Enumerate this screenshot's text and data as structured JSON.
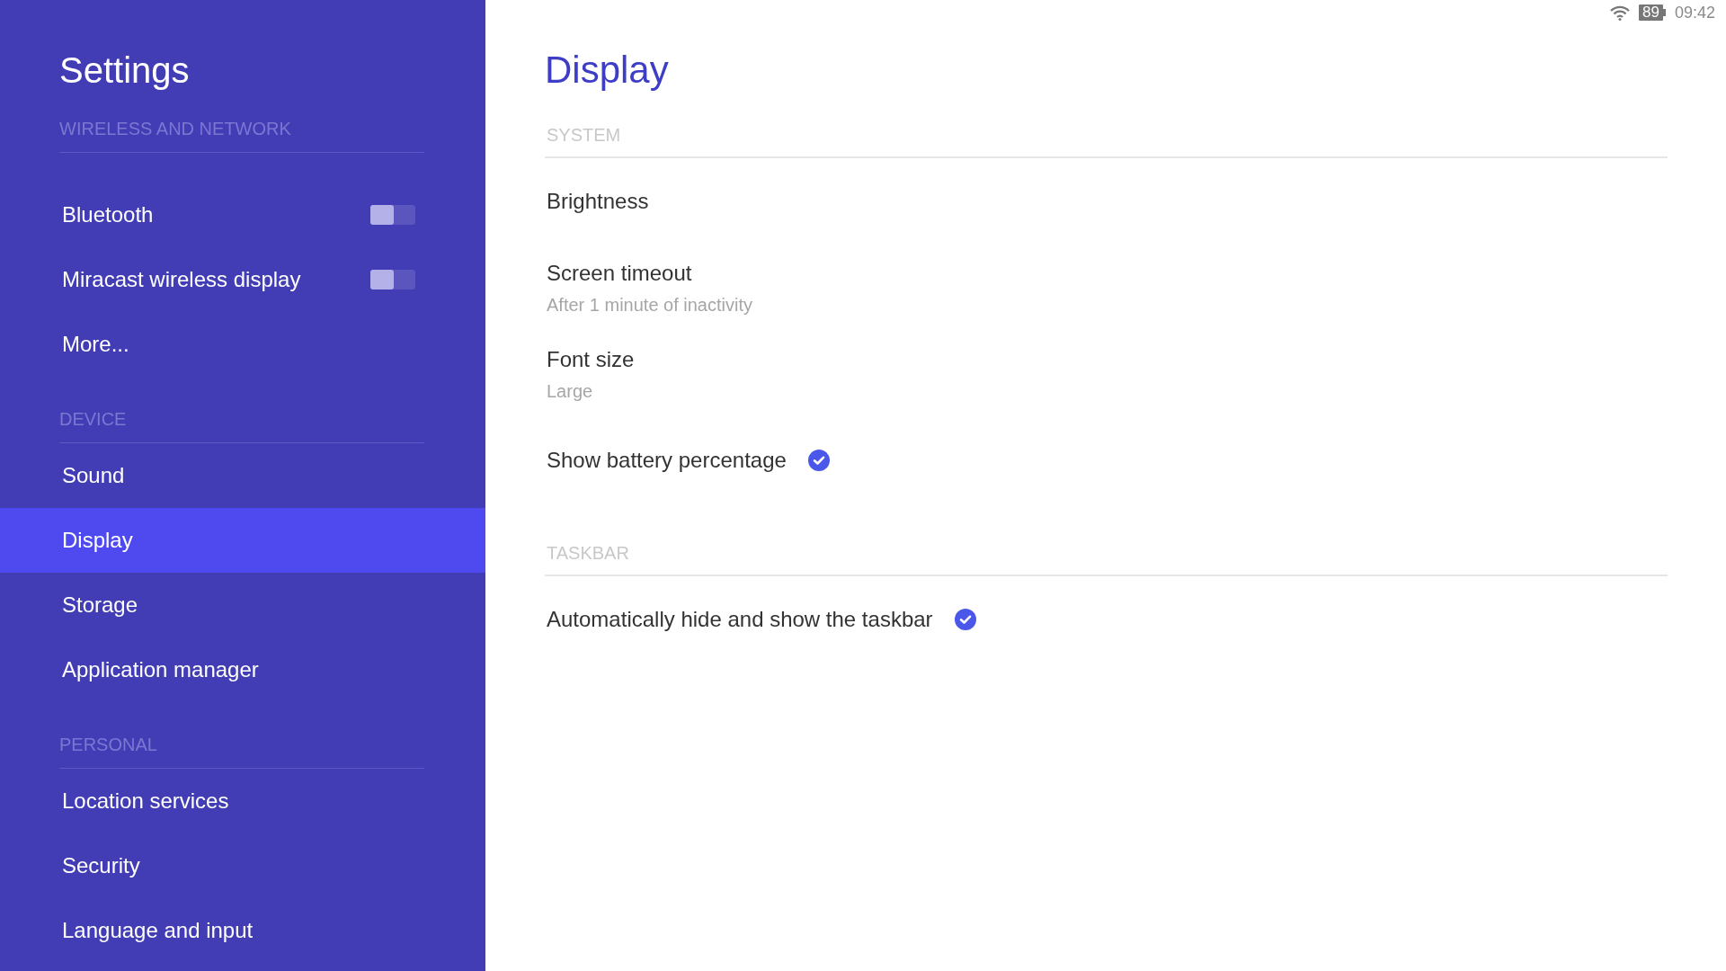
{
  "status_bar": {
    "battery": "89",
    "time": "09:42"
  },
  "sidebar": {
    "title": "Settings",
    "sections": [
      {
        "header": "WIRELESS AND NETWORK",
        "items": [
          {
            "label": "Bluetooth",
            "kind": "toggle",
            "on": false,
            "selected": false
          },
          {
            "label": "Miracast wireless display",
            "kind": "toggle",
            "on": false,
            "selected": false
          },
          {
            "label": "More...",
            "kind": "link",
            "selected": false
          }
        ]
      },
      {
        "header": "DEVICE",
        "items": [
          {
            "label": "Sound",
            "kind": "link",
            "selected": false
          },
          {
            "label": "Display",
            "kind": "link",
            "selected": true
          },
          {
            "label": "Storage",
            "kind": "link",
            "selected": false
          },
          {
            "label": "Application manager",
            "kind": "link",
            "selected": false
          }
        ]
      },
      {
        "header": "PERSONAL",
        "items": [
          {
            "label": "Location services",
            "kind": "link",
            "selected": false
          },
          {
            "label": "Security",
            "kind": "link",
            "selected": false
          },
          {
            "label": "Language and input",
            "kind": "link",
            "selected": false
          }
        ]
      }
    ]
  },
  "page": {
    "title": "Display",
    "sections": [
      {
        "header": "SYSTEM",
        "items": [
          {
            "label": "Brightness",
            "kind": "plain"
          },
          {
            "label": "Screen timeout",
            "summary": "After 1 minute of inactivity",
            "kind": "plain"
          },
          {
            "label": "Font size",
            "summary": "Large",
            "kind": "plain"
          },
          {
            "label": "Show battery percentage",
            "kind": "check",
            "checked": true
          }
        ]
      },
      {
        "header": "TASKBAR",
        "items": [
          {
            "label": "Automatically hide and show the taskbar",
            "kind": "check",
            "checked": true
          }
        ]
      }
    ]
  }
}
